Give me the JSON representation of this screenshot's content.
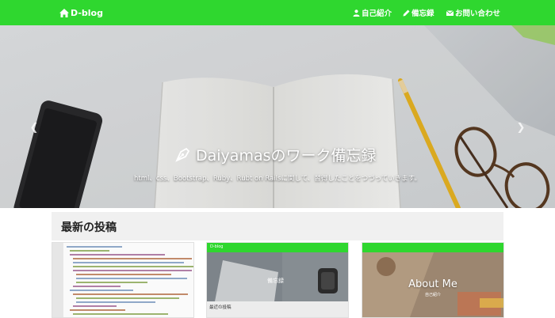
{
  "navbar": {
    "brand": "D-blog",
    "items": [
      {
        "label": "自己紹介",
        "icon": "user-icon"
      },
      {
        "label": "備忘録",
        "icon": "pencil-icon"
      },
      {
        "label": "お問い合わせ",
        "icon": "envelope-icon"
      }
    ],
    "brand_icon": "home-icon",
    "color": "#2fd72f"
  },
  "hero": {
    "title": "Daiyamasのワーク備忘録",
    "subtitle": "html、css、Bootstrap、Ruby、Rubt on Railsに関して、習得したことをつづっていきます。",
    "title_icon": "pen-nib-icon",
    "prev_icon": "chevron-left-icon",
    "next_icon": "chevron-right-icon",
    "active_slide": 1,
    "slide_count": 3
  },
  "main": {
    "section_title": "最新の投稿",
    "posts": [
      {
        "thumbnail": "code-screenshot"
      },
      {
        "thumbnail": "blog-screenshot",
        "mini_brand": "D-blog",
        "mini_title": "備忘録",
        "mini_section": "最近の投稿"
      },
      {
        "thumbnail": "about-page",
        "title": "About Me",
        "subtitle": "自己紹介"
      }
    ]
  }
}
